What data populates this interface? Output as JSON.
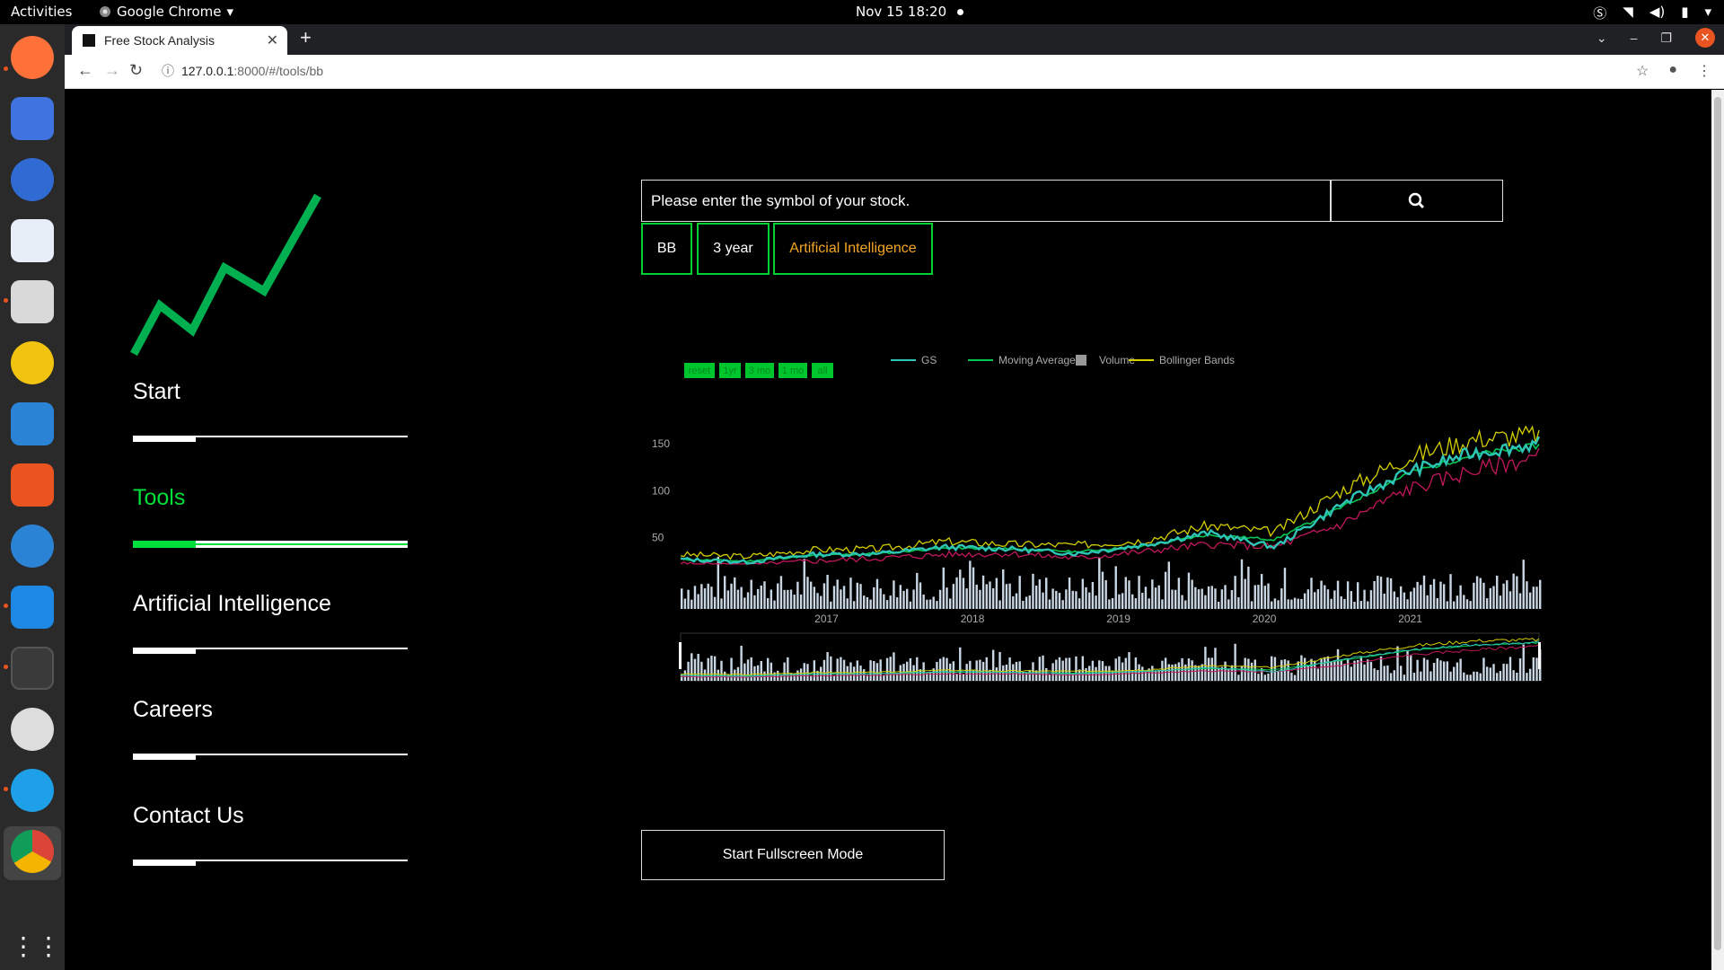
{
  "os": {
    "activities": "Activities",
    "app_name": "Google Chrome",
    "clock": "Nov 15  18:20"
  },
  "browser": {
    "tab_title": "Free Stock Analysis",
    "url_host": "127.0.0.1",
    "url_path": ":8000/#/tools/bb"
  },
  "nav": {
    "items": [
      {
        "label": "Start",
        "active": false
      },
      {
        "label": "Tools",
        "active": true
      },
      {
        "label": "Artificial Intelligence",
        "active": false
      },
      {
        "label": "Careers",
        "active": false
      },
      {
        "label": "Contact Us",
        "active": false
      }
    ]
  },
  "search": {
    "placeholder": "Please enter the symbol of your stock."
  },
  "tags": [
    "BB",
    "3 year",
    "Artificial Intelligence"
  ],
  "range_buttons": [
    "reset",
    "1yr",
    "3 mo",
    "1 mo",
    "all"
  ],
  "fullscreen_label": "Start Fullscreen Mode",
  "colors": {
    "accent_green": "#00e03a",
    "series_gs": "#2ec4b6",
    "series_ma": "#00c853",
    "series_bb": "#d4cf00",
    "series_lower": "#c2185b",
    "volume": "#c9d6e3",
    "ai_text": "#f5a623"
  },
  "chart_data": {
    "type": "line",
    "legend": [
      "GS",
      "Moving Average",
      "Volume",
      "Bollinger Bands"
    ],
    "legend_position": "top",
    "x_ticks": [
      "2017",
      "2018",
      "2019",
      "2020",
      "2021"
    ],
    "y_ticks": [
      50,
      100,
      150
    ],
    "ylim": [
      20,
      170
    ],
    "x": [
      "2016-01",
      "2016-07",
      "2017-01",
      "2017-07",
      "2018-01",
      "2018-07",
      "2019-01",
      "2019-07",
      "2020-01",
      "2020-03",
      "2020-07",
      "2021-01",
      "2021-07",
      "2021-11"
    ],
    "series": [
      {
        "name": "GS",
        "values": [
          27,
          24,
          32,
          33,
          40,
          38,
          33,
          42,
          55,
          40,
          85,
          120,
          140,
          150
        ]
      },
      {
        "name": "Moving Average",
        "values": [
          27,
          25,
          31,
          33,
          39,
          38,
          35,
          41,
          53,
          48,
          82,
          118,
          138,
          148
        ]
      },
      {
        "name": "Bollinger Bands",
        "values": [
          32,
          30,
          37,
          38,
          46,
          43,
          42,
          47,
          63,
          56,
          100,
          135,
          155,
          160
        ]
      }
    ],
    "grid": false
  }
}
